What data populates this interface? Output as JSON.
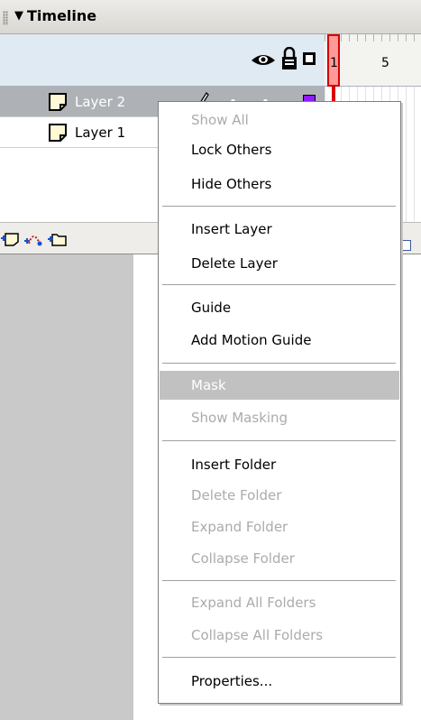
{
  "panel": {
    "title": "Timeline",
    "collapse_icon": "triangle-down-icon"
  },
  "header": {
    "eye_icon": "eye-icon",
    "lock_icon": "lock-icon",
    "outline_icon": "outline-square-icon"
  },
  "ruler": {
    "frame_labels": [
      "1",
      "5"
    ],
    "playhead_frame": 1
  },
  "layers": [
    {
      "name": "Layer 2",
      "selected": true,
      "color": "#8e1dff"
    },
    {
      "name": "Layer 1",
      "selected": false
    }
  ],
  "toolbar": {
    "icons": [
      "insert-layer-icon",
      "add-motion-guide-icon",
      "insert-folder-icon"
    ]
  },
  "context_menu": {
    "items": [
      {
        "label": "Show All",
        "enabled": false
      },
      {
        "label": "Lock Others",
        "enabled": true
      },
      {
        "label": "Hide Others",
        "enabled": true
      },
      {
        "label": "Insert Layer",
        "enabled": true
      },
      {
        "label": "Delete Layer",
        "enabled": true
      },
      {
        "label": "Guide",
        "enabled": true
      },
      {
        "label": "Add Motion Guide",
        "enabled": true
      },
      {
        "label": "Mask",
        "enabled": false,
        "highlighted": true
      },
      {
        "label": "Show Masking",
        "enabled": false
      },
      {
        "label": "Insert Folder",
        "enabled": true
      },
      {
        "label": "Delete Folder",
        "enabled": false
      },
      {
        "label": "Expand Folder",
        "enabled": false
      },
      {
        "label": "Collapse Folder",
        "enabled": false
      },
      {
        "label": "Expand All Folders",
        "enabled": false
      },
      {
        "label": "Collapse All Folders",
        "enabled": false
      },
      {
        "label": "Properties...",
        "enabled": true
      }
    ]
  },
  "colors": {
    "selected_row": "#aeb2b6",
    "menu_highlight": "#c1c1c1",
    "playhead": "#d80000"
  }
}
